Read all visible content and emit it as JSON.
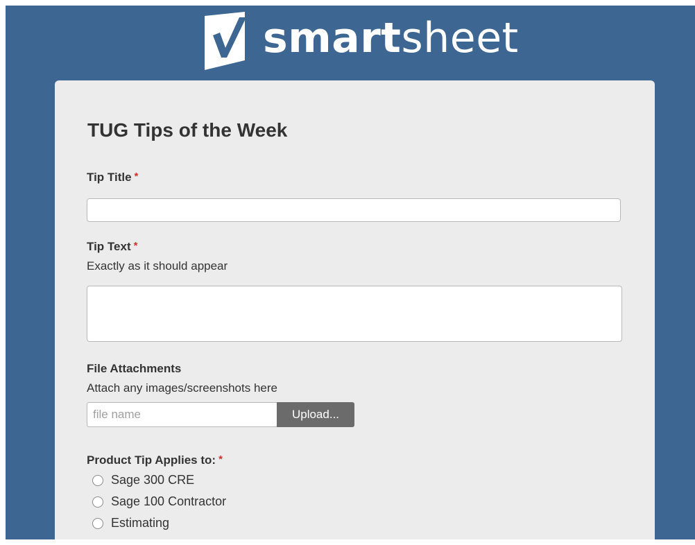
{
  "brand": {
    "name_bold": "smart",
    "name_light": "sheet",
    "logo_icon": "checkmark-flag-icon"
  },
  "form": {
    "title": "TUG Tips of the Week",
    "required_marker": "*",
    "fields": {
      "tip_title": {
        "label": "Tip Title",
        "value": "",
        "placeholder": ""
      },
      "tip_text": {
        "label": "Tip Text",
        "description": "Exactly as it should appear",
        "value": "",
        "placeholder": ""
      },
      "file_attachments": {
        "label": "File Attachments",
        "description": "Attach any images/screenshots here",
        "file_placeholder": "file name",
        "upload_label": "Upload..."
      },
      "product": {
        "label": "Product Tip Applies to:",
        "options": [
          {
            "label": "Sage 300 CRE",
            "selected": false
          },
          {
            "label": "Sage 100 Contractor",
            "selected": false
          },
          {
            "label": "Estimating",
            "selected": false
          }
        ]
      }
    }
  },
  "colors": {
    "background": "#3d6693",
    "card": "#ececec",
    "required": "#d0312d",
    "upload_button": "#6b6b6b"
  }
}
